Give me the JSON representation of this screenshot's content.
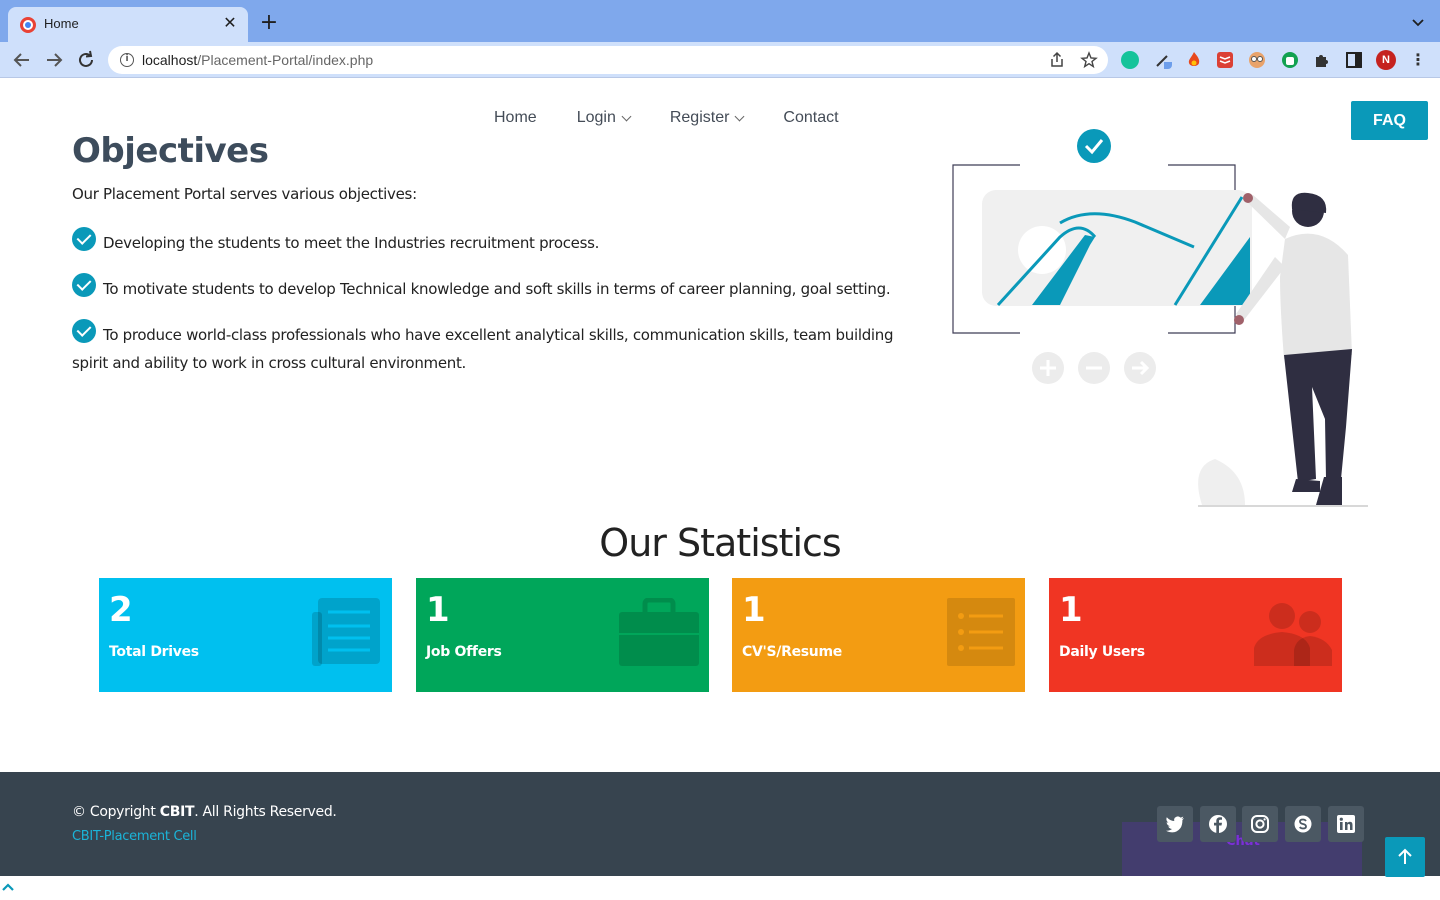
{
  "browser": {
    "tab_title": "Home",
    "tab_close": "✕",
    "new_tab": "+",
    "url_host": "localhost",
    "url_path": "/Placement-Portal/index.php",
    "profile_initial": "N"
  },
  "nav": {
    "home": "Home",
    "login": "Login",
    "register": "Register",
    "contact": "Contact",
    "faq": "FAQ"
  },
  "objectives": {
    "title": "Objectives",
    "intro": "Our Placement Portal serves various objectives:",
    "items": [
      "Developing the students to meet the Industries recruitment process.",
      "To motivate students to develop Technical knowledge and soft skills in terms of career planning, goal setting.",
      "To produce world-class professionals who have excellent analytical skills, communication skills, team building spirit and ability to work in cross cultural environment."
    ]
  },
  "statistics": {
    "title": "Our Statistics",
    "cards": [
      {
        "value": "2",
        "label": "Total Drives",
        "color": "#00c0ef",
        "icon": "newspaper-icon"
      },
      {
        "value": "1",
        "label": "Job Offers",
        "color": "#00a65a",
        "icon": "briefcase-icon"
      },
      {
        "value": "1",
        "label": "CV'S/Resume",
        "color": "#f39c12",
        "icon": "list-icon"
      },
      {
        "value": "1",
        "label": "Daily Users",
        "color": "#f03523",
        "icon": "users-icon"
      }
    ]
  },
  "footer": {
    "copyright_prefix": "© Copyright ",
    "copyright_org": "CBIT",
    "copyright_suffix": ". All Rights Reserved.",
    "cell_link": "CBIT-Placement Cell",
    "chat": "Chat"
  },
  "colors": {
    "accent": "#0a99b9",
    "footer_bg": "#37444f"
  }
}
